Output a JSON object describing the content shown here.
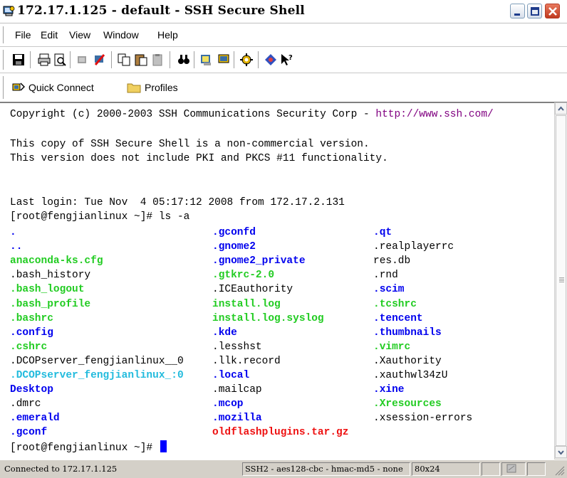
{
  "window": {
    "title": "172.17.1.125 - default - SSH Secure Shell",
    "icon": "ssh-app-icon"
  },
  "menu": {
    "items": [
      {
        "label": "File"
      },
      {
        "label": "Edit"
      },
      {
        "label": "View"
      },
      {
        "label": "Window"
      },
      {
        "label": "Help"
      }
    ]
  },
  "toolbar": {
    "buttons": [
      "save-icon",
      "print-icon",
      "print-preview-icon",
      "connect-icon",
      "disconnect-icon",
      "copy-icon",
      "paste-icon",
      "paste-disabled-icon",
      "find-icon",
      "file-transfer-icon",
      "new-terminal-icon",
      "settings-icon",
      "help-icon",
      "whats-this-icon"
    ]
  },
  "quickbar": {
    "quick_connect": "Quick Connect",
    "profiles": "Profiles"
  },
  "terminal": {
    "copyright_prefix": "Copyright (c) 2000-2003 SSH Communications Security Corp - ",
    "copyright_link": "http://www.ssh.com/",
    "notice1": "This copy of SSH Secure Shell is a non-commercial version.",
    "notice2": "This version does not include PKI and PKCS #11 functionality.",
    "last_login": "Last login: Tue Nov  4 05:17:12 2008 from 172.17.2.131",
    "prompt1": "[root@fengjianlinux ~]# ls -a",
    "prompt2": "[root@fengjianlinux ~]# ",
    "listing": [
      [
        {
          "t": ".",
          "c": "blue"
        },
        {
          "t": ".gconfd",
          "c": "blue"
        },
        {
          "t": ".qt",
          "c": "blue"
        }
      ],
      [
        {
          "t": "..",
          "c": "blue"
        },
        {
          "t": ".gnome2",
          "c": "blue"
        },
        {
          "t": ".realplayerrc",
          "c": "plain"
        }
      ],
      [
        {
          "t": "anaconda-ks.cfg",
          "c": "green"
        },
        {
          "t": ".gnome2_private",
          "c": "blue"
        },
        {
          "t": "res.db",
          "c": "plain"
        }
      ],
      [
        {
          "t": ".bash_history",
          "c": "plain"
        },
        {
          "t": ".gtkrc-2.0",
          "c": "green"
        },
        {
          "t": ".rnd",
          "c": "plain"
        }
      ],
      [
        {
          "t": ".bash_logout",
          "c": "green"
        },
        {
          "t": ".ICEauthority",
          "c": "plain"
        },
        {
          "t": ".scim",
          "c": "blue"
        }
      ],
      [
        {
          "t": ".bash_profile",
          "c": "green"
        },
        {
          "t": "install.log",
          "c": "green"
        },
        {
          "t": ".tcshrc",
          "c": "green"
        }
      ],
      [
        {
          "t": ".bashrc",
          "c": "green"
        },
        {
          "t": "install.log.syslog",
          "c": "green"
        },
        {
          "t": ".tencent",
          "c": "blue"
        }
      ],
      [
        {
          "t": ".config",
          "c": "blue"
        },
        {
          "t": ".kde",
          "c": "blue"
        },
        {
          "t": ".thumbnails",
          "c": "blue"
        }
      ],
      [
        {
          "t": ".cshrc",
          "c": "green"
        },
        {
          "t": ".lesshst",
          "c": "plain"
        },
        {
          "t": ".vimrc",
          "c": "green"
        }
      ],
      [
        {
          "t": ".DCOPserver_fengjianlinux__0",
          "c": "plain"
        },
        {
          "t": ".llk.record",
          "c": "plain"
        },
        {
          "t": ".Xauthority",
          "c": "plain"
        }
      ],
      [
        {
          "t": ".DCOPserver_fengjianlinux_:0",
          "c": "cyan"
        },
        {
          "t": ".local",
          "c": "blue"
        },
        {
          "t": ".xauthwl34zU",
          "c": "plain"
        }
      ],
      [
        {
          "t": "Desktop",
          "c": "blue"
        },
        {
          "t": ".mailcap",
          "c": "plain"
        },
        {
          "t": ".xine",
          "c": "blue"
        }
      ],
      [
        {
          "t": ".dmrc",
          "c": "plain"
        },
        {
          "t": ".mcop",
          "c": "blue"
        },
        {
          "t": ".Xresources",
          "c": "green"
        }
      ],
      [
        {
          "t": ".emerald",
          "c": "blue"
        },
        {
          "t": ".mozilla",
          "c": "blue"
        },
        {
          "t": ".xsession-errors",
          "c": "plain"
        }
      ],
      [
        {
          "t": ".gconf",
          "c": "blue"
        },
        {
          "t": "oldflashplugins.tar.gz",
          "c": "red"
        },
        {
          "t": "",
          "c": "plain"
        }
      ]
    ]
  },
  "status": {
    "connection": "Connected to 172.17.1.125",
    "cipher": "SSH2 - aes128-cbc - hmac-md5 - none",
    "size": "80x24"
  },
  "colors": {
    "dir": "#0000ee",
    "exec": "#22cc22",
    "socket": "#22bbdd",
    "archive": "#ee1111",
    "cursor": "#0000ff"
  }
}
